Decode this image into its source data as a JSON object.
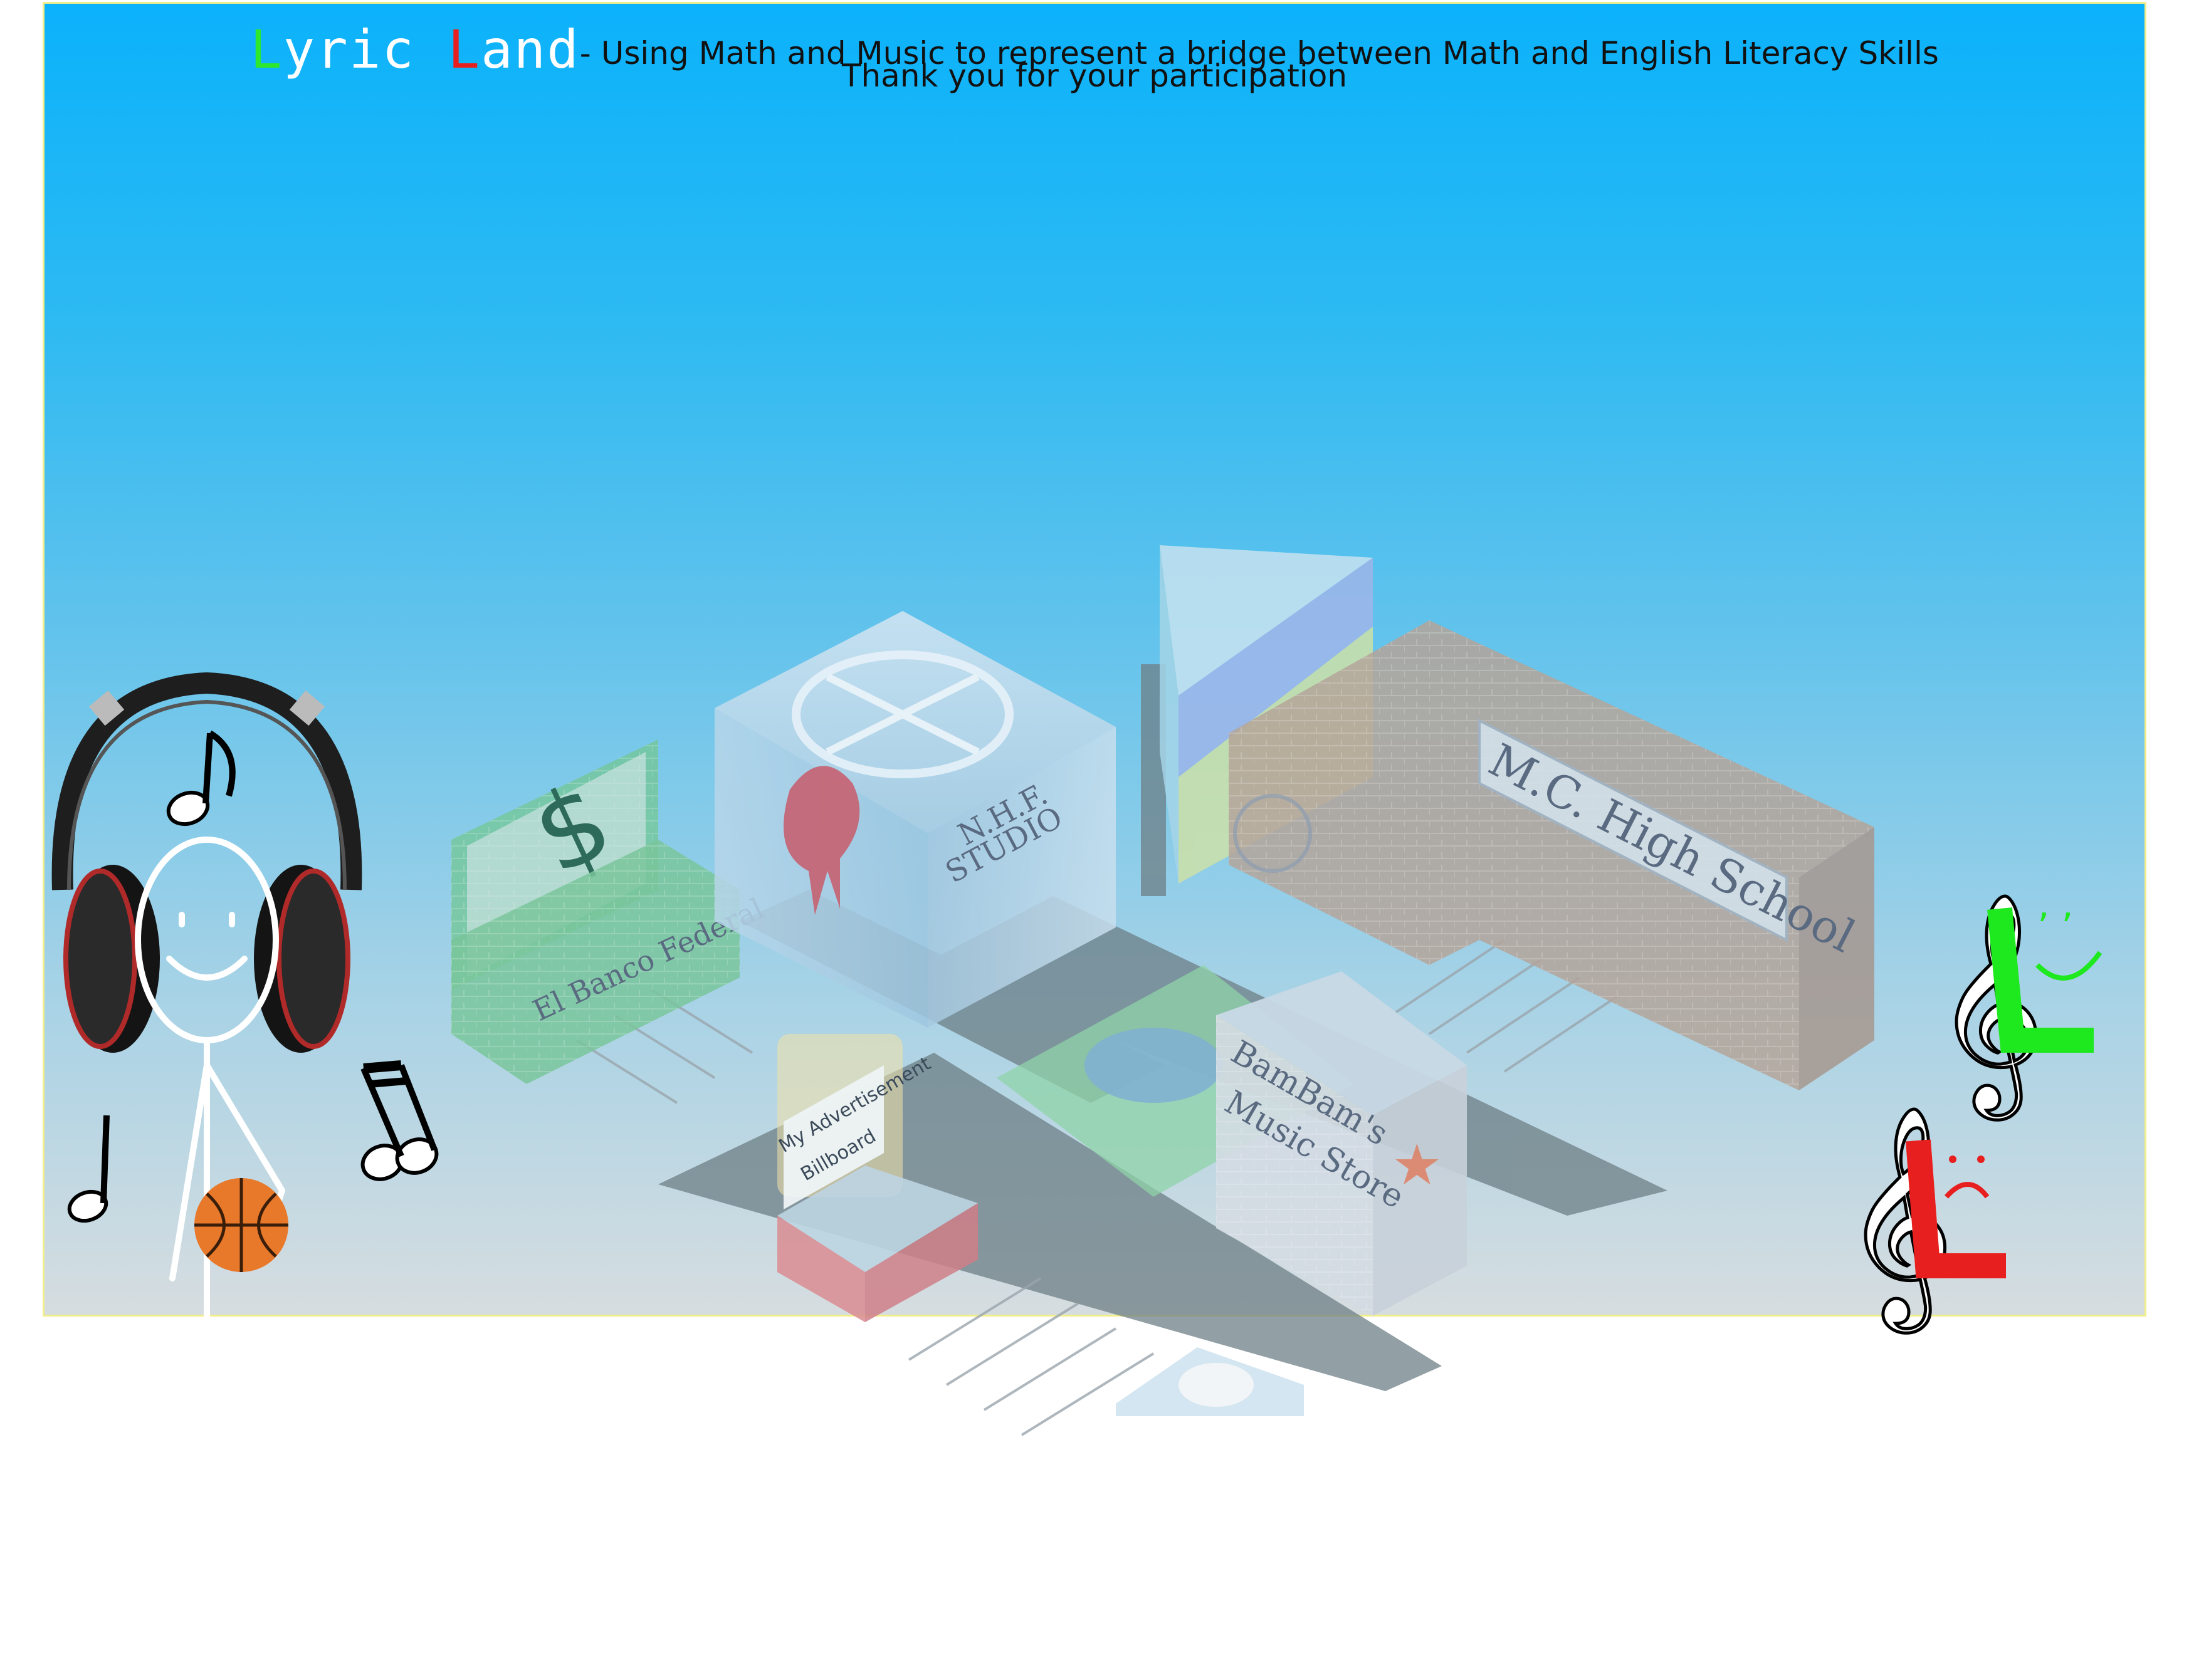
{
  "header": {
    "logo": {
      "word1_initial": "L",
      "word1_rest": "yric ",
      "word2_initial": "L",
      "word2_rest": "and"
    },
    "subtitle": "- Using Math and Music to represent a bridge between Math and English Literacy Skills",
    "thanks": "Thank you for your participation"
  },
  "buildings": {
    "bank": "El Banco Federal",
    "studio_line1": "N.H.F.",
    "studio_line2": "STUDIO",
    "school": "M.C. High School",
    "billboard_line1": "My Advertisement",
    "billboard_line2": "Billboard",
    "store_line1": "BamBam's",
    "store_line2": "Music Store"
  },
  "colors": {
    "sky_top": "#0bb2fb",
    "sky_bottom": "#d6dde0",
    "frame_border": "#f2ee8a",
    "logo_green": "#2ee82e",
    "logo_red": "#e81f1f",
    "road": "#6d7f86",
    "basketball": "#e8782a"
  },
  "icons": [
    "headphones-icon",
    "music-note-icon",
    "eighth-notes-icon",
    "basketball-icon",
    "treble-clef-happy-icon",
    "treble-clef-sad-icon",
    "dollar-sign-icon",
    "music-disc-icon"
  ]
}
